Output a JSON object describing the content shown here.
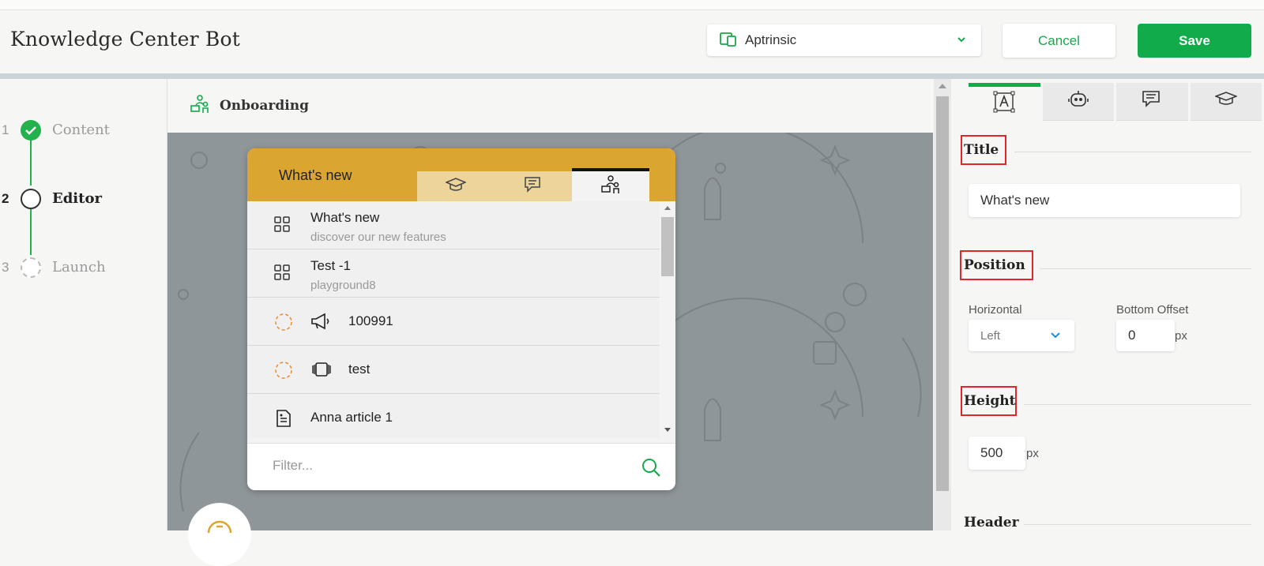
{
  "header": {
    "title": "Knowledge Center Bot",
    "app_select_value": "Aptrinsic",
    "cancel_label": "Cancel",
    "save_label": "Save"
  },
  "steps": [
    {
      "num": "1",
      "label": "Content",
      "state": "done"
    },
    {
      "num": "2",
      "label": "Editor",
      "state": "active"
    },
    {
      "num": "3",
      "label": "Launch",
      "state": "pending"
    }
  ],
  "canvas": {
    "title": "Onboarding"
  },
  "widget": {
    "title": "What's new",
    "tabs": [
      "graduation-cap-icon",
      "chat-icon",
      "onboarding-icon"
    ],
    "items": [
      {
        "title": "What's new",
        "subtitle": "discover our new features",
        "icon": "grid-icon"
      },
      {
        "title": "Test -1",
        "subtitle": "playground8",
        "icon": "grid-icon"
      },
      {
        "title": "100991",
        "icon": "megaphone-icon",
        "status": "dashed-circle"
      },
      {
        "title": "test",
        "icon": "carousel-icon",
        "status": "dashed-circle"
      },
      {
        "title": "Anna article 1",
        "icon": "article-icon"
      }
    ],
    "filter_placeholder": "Filter..."
  },
  "panel": {
    "tabs": [
      "text-icon",
      "robot-icon",
      "chat-icon",
      "graduation-cap-icon"
    ],
    "title_section": "Title",
    "title_value": "What's new",
    "position_section": "Position",
    "horizontal_label": "Horizontal",
    "horizontal_value": "Left",
    "bottom_offset_label": "Bottom Offset",
    "bottom_offset_value": "0",
    "unit_px": "px",
    "height_section": "Height",
    "height_value": "500",
    "header_section": "Header"
  },
  "colors": {
    "accent": "#12ab4a",
    "widget_header": "#dba62f",
    "canvas_bg": "#8f9699",
    "highlight": "#e0252b"
  }
}
